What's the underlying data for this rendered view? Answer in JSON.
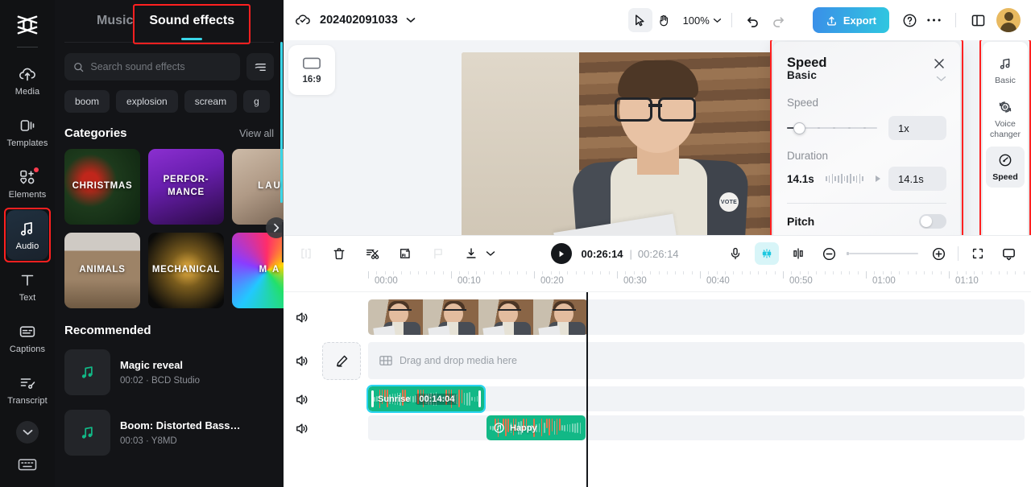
{
  "rail": {
    "logo_icon": "capcut-logo-icon",
    "items": [
      {
        "label": "Media",
        "icon": "media-cloud-icon",
        "active": false,
        "badge": false
      },
      {
        "label": "Templates",
        "icon": "templates-icon",
        "active": false,
        "badge": false
      },
      {
        "label": "Elements",
        "icon": "elements-icon",
        "active": false,
        "badge": true
      },
      {
        "label": "Audio",
        "icon": "audio-note-icon",
        "active": true,
        "badge": false
      },
      {
        "label": "Text",
        "icon": "text-icon",
        "active": false,
        "badge": false
      },
      {
        "label": "Captions",
        "icon": "captions-icon",
        "active": false,
        "badge": false
      },
      {
        "label": "Transcript",
        "icon": "transcript-icon",
        "active": false,
        "badge": false
      }
    ],
    "more_icon": "chevron-down-icon",
    "shortcuts_icon": "keyboard-icon"
  },
  "panel": {
    "tabs": [
      {
        "label": "Music",
        "active": false
      },
      {
        "label": "Sound effects",
        "active": true
      }
    ],
    "search": {
      "placeholder": "Search sound effects",
      "value": "",
      "icon": "search-icon"
    },
    "filter_icon": "filter-icon",
    "chips": [
      "boom",
      "explosion",
      "scream",
      "g"
    ],
    "categories_heading": "Categories",
    "view_all": "View all",
    "categories": [
      {
        "label": "CHRISTMAS"
      },
      {
        "label": "PERFOR-\nMANCE"
      },
      {
        "label": "LAU"
      },
      {
        "label": "ANIMALS"
      },
      {
        "label": "MECHANICAL"
      },
      {
        "label": "M A"
      }
    ],
    "next_icon": "chevron-right-icon",
    "recommended_heading": "Recommended",
    "recommended": [
      {
        "title": "Magic reveal",
        "meta": "00:02 · BCD Studio",
        "icon": "music-note-icon"
      },
      {
        "title": "Boom: Distorted Bass…",
        "meta": "00:03 · Y8MD",
        "icon": "music-note-icon"
      }
    ],
    "collapse_icon": "chevron-left-icon"
  },
  "topbar": {
    "cloud_icon": "cloud-saved-icon",
    "project_name": "202402091033",
    "project_chevron": "chevron-down-icon",
    "select_tool_icon": "cursor-arrow-icon",
    "hand_tool_icon": "hand-icon",
    "zoom_level": "100%",
    "zoom_chevron": "chevron-down-icon",
    "undo_icon": "undo-icon",
    "redo_icon": "redo-icon",
    "export_label": "Export",
    "export_icon": "upload-icon",
    "help_icon": "help-circle-icon",
    "more_icon": "more-dots-icon",
    "layout_icon": "split-layout-icon",
    "avatar_icon": "avatar"
  },
  "stage": {
    "ratio_label": "16:9",
    "ratio_icon": "aspect-ratio-icon",
    "preview_badge_text": "VOTE"
  },
  "speed_panel": {
    "title": "Speed",
    "close_icon": "close-icon",
    "clipped_tab": "Basic",
    "clipped_chevron": "chevron-down-icon",
    "speed_label": "Speed",
    "speed_value": "1x",
    "duration_label": "Duration",
    "duration_current": "14.1s",
    "duration_value": "14.1s",
    "pitch_label": "Pitch",
    "pitch_on": false
  },
  "right_rail": {
    "items": [
      {
        "label": "Basic",
        "icon": "audio-note-icon",
        "active": false
      },
      {
        "label": "Voice\nchanger",
        "icon": "voice-changer-icon",
        "active": false
      },
      {
        "label": "Speed",
        "icon": "speedometer-icon",
        "active": true
      }
    ]
  },
  "timeline_toolbar": {
    "split_icon": "split-icon",
    "delete_icon": "trash-icon",
    "ai_cut_icon": "auto-cut-icon",
    "ai_frame_icon": "ai-frame-icon",
    "marker_icon": "flag-icon",
    "download_icon": "download-icon",
    "download_chevron": "chevron-down-icon",
    "play_icon": "play-icon",
    "current_time": "00:26:14",
    "separator": "|",
    "total_time": "00:26:14",
    "mic_icon": "microphone-icon",
    "magic_icon": "auto-enhance-icon",
    "keyframe_icon": "keyframe-icon",
    "zoom_out_icon": "zoom-out-icon",
    "zoom_in_icon": "zoom-in-icon",
    "fullscreen_icon": "fullscreen-icon",
    "display_icon": "display-icon"
  },
  "timeline": {
    "ruler_labels": [
      "00:00",
      "00:10",
      "00:20",
      "00:30",
      "00:40",
      "00:50",
      "01:00",
      "01:10"
    ],
    "tracks": [
      {
        "type": "video",
        "mute_icon": "speaker-icon",
        "clip_label": ""
      },
      {
        "type": "placeholder",
        "mute_icon": "speaker-icon",
        "edit_icon": "pencil-icon",
        "drop_icon": "media-film-icon",
        "drop_text": "Drag and drop media here"
      },
      {
        "type": "audio",
        "mute_icon": "speaker-icon",
        "clip_label": "Sunrise",
        "clip_time": "00:14:04",
        "selected": true
      },
      {
        "type": "audio",
        "mute_icon": "speaker-icon",
        "clip_label": "Happy",
        "clip_icon": "music-disc-icon",
        "selected": false
      }
    ]
  },
  "colors": {
    "accent_cyan": "#3ad6e8",
    "export_gradient_start": "#3a8fe8",
    "export_gradient_end": "#2fc7e0",
    "highlight_red": "#ff2020",
    "audio_clip_green": "#12b886",
    "panel_dark": "#131417"
  }
}
